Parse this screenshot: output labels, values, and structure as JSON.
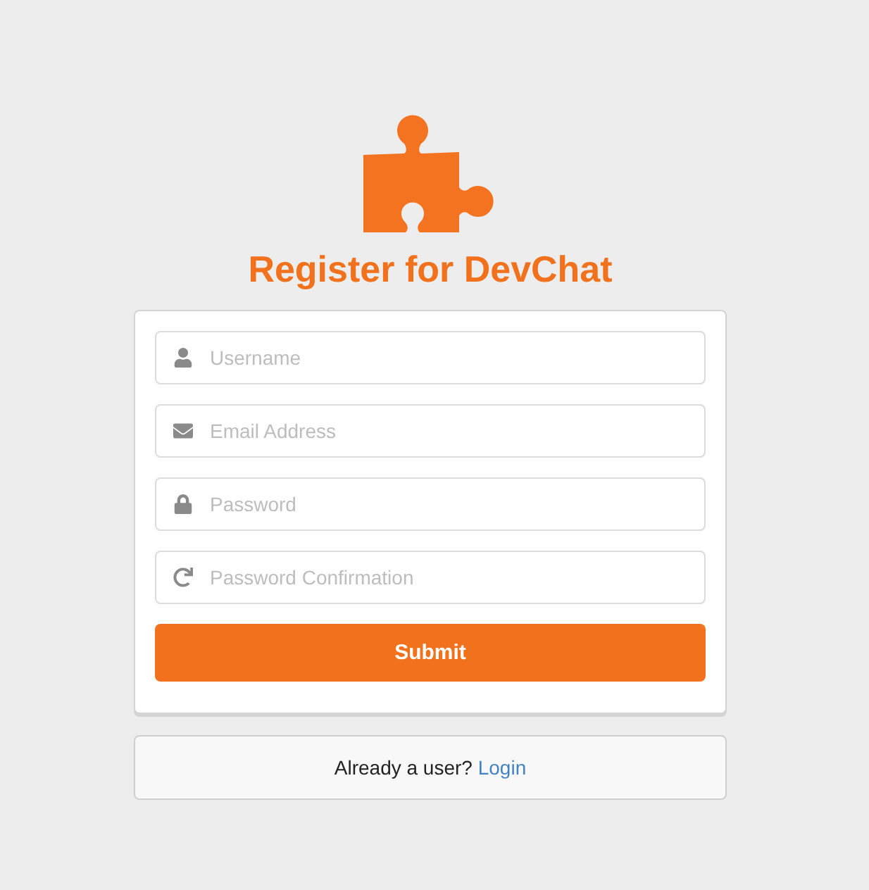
{
  "header": {
    "title": "Register for DevChat"
  },
  "form": {
    "fields": [
      {
        "kind": "user",
        "placeholder": "Username"
      },
      {
        "kind": "email",
        "placeholder": "Email Address"
      },
      {
        "kind": "password",
        "placeholder": "Password"
      },
      {
        "kind": "confirm",
        "placeholder": "Password Confirmation"
      }
    ],
    "submit": "Submit"
  },
  "message": {
    "text": "Already a user?",
    "link": "Login"
  }
}
